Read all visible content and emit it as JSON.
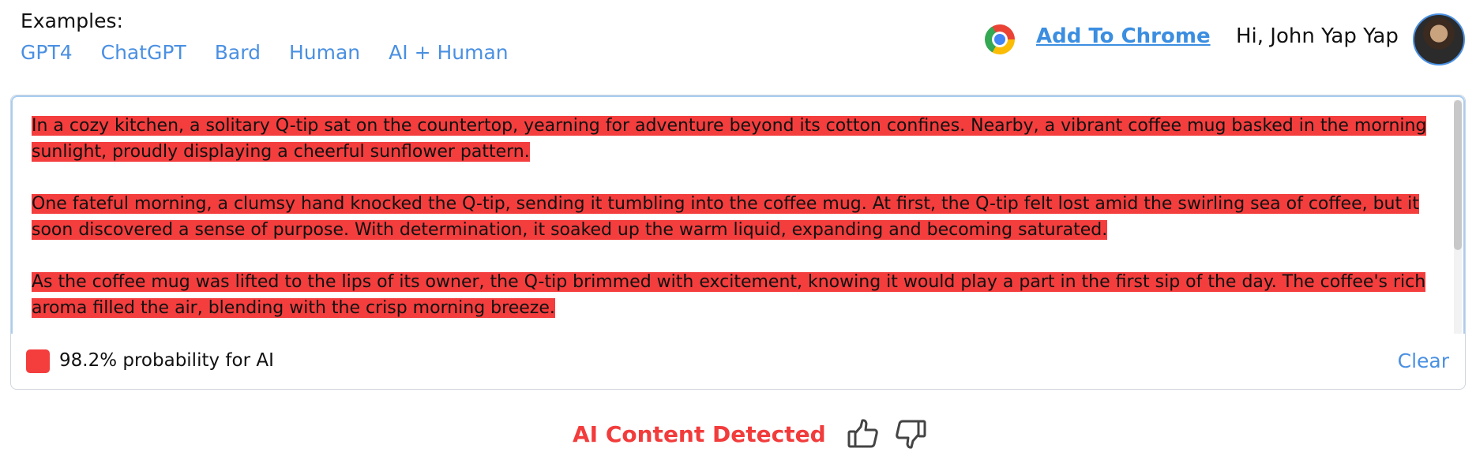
{
  "examples": {
    "label": "Examples:",
    "items": [
      {
        "label": "GPT4"
      },
      {
        "label": "ChatGPT"
      },
      {
        "label": "Bard"
      },
      {
        "label": "Human"
      },
      {
        "label": "AI + Human"
      }
    ]
  },
  "header": {
    "chrome_icon": "chrome-icon",
    "add_to_chrome": "Add To Chrome",
    "greeting": "Hi, John Yap Yap",
    "avatar": "user-avatar"
  },
  "detector": {
    "paragraphs": [
      {
        "text": "In a cozy kitchen, a solitary Q-tip sat on the countertop, yearning for adventure beyond its cotton confines. Nearby, a vibrant coffee mug basked in the morning sunlight, proudly displaying a cheerful sunflower pattern."
      },
      {
        "text": "One fateful morning, a clumsy hand knocked the Q-tip, sending it tumbling into the coffee mug. At first, the Q-tip felt lost amid the swirling sea of coffee, but it soon discovered a sense of purpose. With determination, it soaked up the warm liquid, expanding and becoming saturated."
      },
      {
        "text": "As the coffee mug was lifted to the lips of its owner, the Q-tip brimmed with excitement, knowing it would play a part in the first sip of the day. The coffee's rich aroma filled the air, blending with the crisp morning breeze."
      }
    ],
    "highlight_color": "#f43d3d",
    "probability_text": "98.2% probability for AI",
    "clear_label": "Clear"
  },
  "result": {
    "label": "AI Content Detected",
    "color": "#f23c3c",
    "thumbs_up_icon": "thumbs-up-icon",
    "thumbs_down_icon": "thumbs-down-icon"
  }
}
